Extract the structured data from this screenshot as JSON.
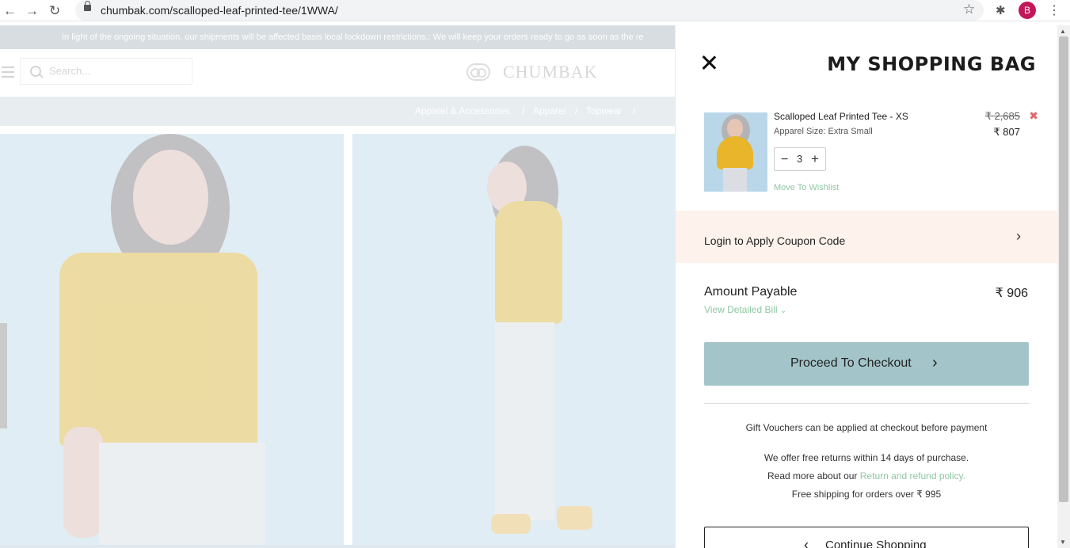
{
  "browser": {
    "url": "chumbak.com/scalloped-leaf-printed-tee/1WWA/",
    "profile_initial": "B"
  },
  "page": {
    "notice": "In light of the ongoing situation, our shipments will be affected basis local lockdown restrictions.: We will keep your orders ready to go as soon as the re",
    "search_placeholder": "Search...",
    "logo_text": "CHUMBAK",
    "breadcrumb": [
      "Apparel & Accessories",
      "Apparel",
      "Topwear"
    ]
  },
  "bag": {
    "title": "MY SHOPPING BAG",
    "item": {
      "name": "Scalloped Leaf Printed Tee - XS",
      "size": "Apparel Size: Extra Small",
      "price_old": "₹ 2,685",
      "price_new": "₹ 807",
      "quantity": "3",
      "wishlist_label": "Move To Wishlist"
    },
    "coupon_label": "Login to Apply Coupon Code",
    "amount_label": "Amount Payable",
    "amount_value": "₹ 906",
    "detailed_bill_label": "View Detailed Bill",
    "checkout_label": "Proceed To Checkout",
    "gift_note": "Gift Vouchers can be applied at checkout before payment",
    "returns_note": "We offer free returns within 14 days of purchase.",
    "read_more_prefix": "Read more about our",
    "policy_link": "Return and refund policy.",
    "shipping_note": "Free shipping for orders over ₹ 995",
    "continue_label": "Continue Shopping"
  },
  "colors": {
    "checkout_button": "#a3c5c9",
    "link_green": "#8fc7a3",
    "coupon_bg": "#fdf3ec",
    "remove_red": "#e06a6a"
  }
}
